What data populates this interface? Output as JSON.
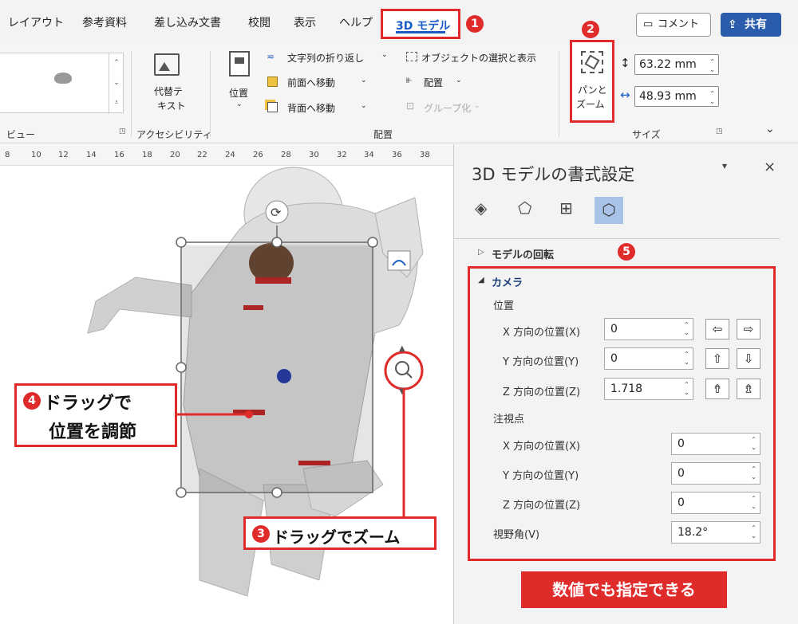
{
  "tabs": [
    {
      "label": "レイアウト"
    },
    {
      "label": "参考資料"
    },
    {
      "label": "差し込み文書"
    },
    {
      "label": "校閲"
    },
    {
      "label": "表示"
    },
    {
      "label": "ヘルプ"
    },
    {
      "label": "3D モデル"
    }
  ],
  "badges": {
    "b1": "1",
    "b2": "2",
    "b4": "4",
    "b3": "3",
    "b5": "5"
  },
  "header": {
    "comment_label": "コメント",
    "share_label": "共有"
  },
  "ribbon": {
    "view_group_label": "ビュー",
    "alt_text_label_1": "代替テ",
    "alt_text_label_2": "キスト",
    "accessibility_group_label": "アクセシビリティ",
    "position_label": "位置",
    "wrap_text_label": "文字列の折り返し",
    "bring_forward_label": "前面へ移動",
    "send_backward_label": "背面へ移動",
    "selection_pane_label": "オブジェクトの選択と表示",
    "align_label": "配置",
    "group_label": "グループ化",
    "arrange_group_label": "配置",
    "pan_zoom_label_1": "パンと",
    "pan_zoom_label_2": "ズーム",
    "height_value": "63.22 mm",
    "width_value": "48.93 mm",
    "size_group_label": "サイズ"
  },
  "ruler": {
    "ticks": [
      "8",
      "10",
      "12",
      "14",
      "16",
      "18",
      "20",
      "22",
      "24",
      "26",
      "28",
      "30",
      "32",
      "34",
      "36",
      "38"
    ]
  },
  "callouts": {
    "drag_position_line1": "ドラッグで",
    "drag_position_line2": "位置を調節",
    "drag_zoom": "ドラッグでズーム"
  },
  "pane": {
    "title": "3D モデルの書式設定",
    "rotation_section": "モデルの回転",
    "camera_section": "カメラ",
    "position_heading": "位置",
    "x_pos_label": "X 方向の位置(X)",
    "y_pos_label": "Y 方向の位置(Y)",
    "z_pos_label": "Z 方向の位置(Z)",
    "x_pos_value": "0",
    "y_pos_value": "0",
    "z_pos_value": "1.718",
    "lookat_heading": "注視点",
    "lookat_x_label": "X 方向の位置(X)",
    "lookat_y_label": "Y 方向の位置(Y)",
    "lookat_z_label": "Z 方向の位置(Z)",
    "lookat_x_value": "0",
    "lookat_y_value": "0",
    "lookat_z_value": "0",
    "fov_label": "視野角(V)",
    "fov_value": "18.2°"
  },
  "banner": "数値でも指定できる",
  "colors": {
    "accent_red": "#e02b2b",
    "word_blue": "#1a5bc4"
  }
}
